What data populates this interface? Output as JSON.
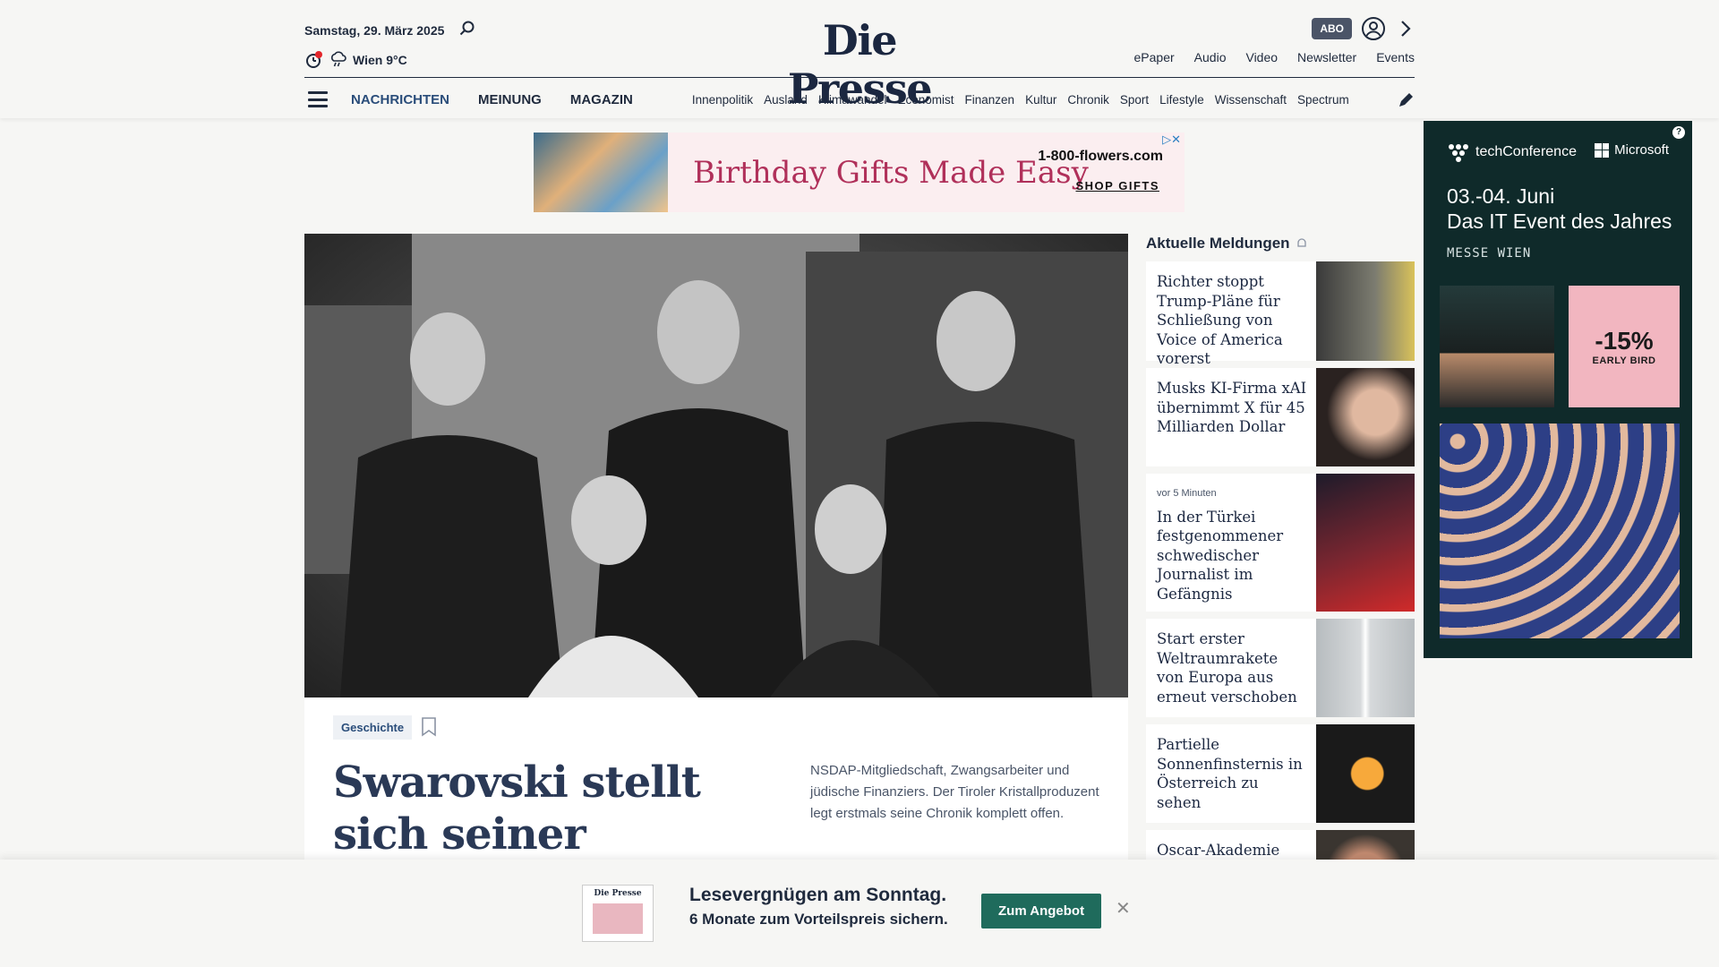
{
  "header": {
    "date": "Samstag, 29. März 2025",
    "weather": "Wien 9°C",
    "logo": "Die Presse",
    "abo_label": "ABO",
    "top_links": [
      "ePaper",
      "Audio",
      "Video",
      "Newsletter",
      "Events"
    ],
    "main_nav": [
      "NACHRICHTEN",
      "MEINUNG",
      "MAGAZIN"
    ],
    "sub_nav": [
      "Innenpolitik",
      "Ausland",
      "Klimawandel",
      "Economist",
      "Finanzen",
      "Kultur",
      "Chronik",
      "Sport",
      "Lifestyle",
      "Wissenschaft",
      "Spectrum"
    ]
  },
  "ad_banner": {
    "headline": "Birthday Gifts Made Easy",
    "brand": "1-800-flowers.com",
    "cta": "SHOP GIFTS"
  },
  "hero": {
    "tag": "Geschichte",
    "title": "Swarovski stellt sich seiner Vergangenheit",
    "lead": "NSDAP-Mitgliedschaft, Zwangsarbeiter und jüdische Finanziers. Der Tiroler Kristallproduzent legt erstmals seine Chronik komplett offen."
  },
  "sidebar": {
    "title": "Aktuelle Meldungen",
    "items": [
      {
        "time": "",
        "title": "Richter stoppt Trump-Pläne für Schließung von Voice of America vorerst"
      },
      {
        "time": "",
        "title": "Musks KI-Firma xAI übernimmt X für 45 Milliarden Dollar"
      },
      {
        "time": "vor 5 Minuten",
        "title": "In der Türkei festgenommener schwedischer Journalist im Gefängnis"
      },
      {
        "time": "",
        "title": "Start erster Weltraumrakete von Europa aus erneut verschoben"
      },
      {
        "time": "",
        "title": "Partielle Sonnenfinsternis in Österreich zu sehen"
      },
      {
        "time": "",
        "title": "Oscar-Akademie"
      }
    ]
  },
  "ad_right": {
    "brand": "techConference",
    "partner": "Microsoft",
    "date": "03.-04. Juni",
    "tagline": "Das IT Event des Jahres",
    "venue": "MESSE WIEN",
    "discount": "-15%",
    "discount_label": "EARLY BIRD"
  },
  "promo": {
    "line1": "Lesevergnügen am Sonntag.",
    "line2": "6 Monate zum Vorteilspreis sichern.",
    "button": "Zum Angebot",
    "thumb_logo": "Die Presse"
  }
}
